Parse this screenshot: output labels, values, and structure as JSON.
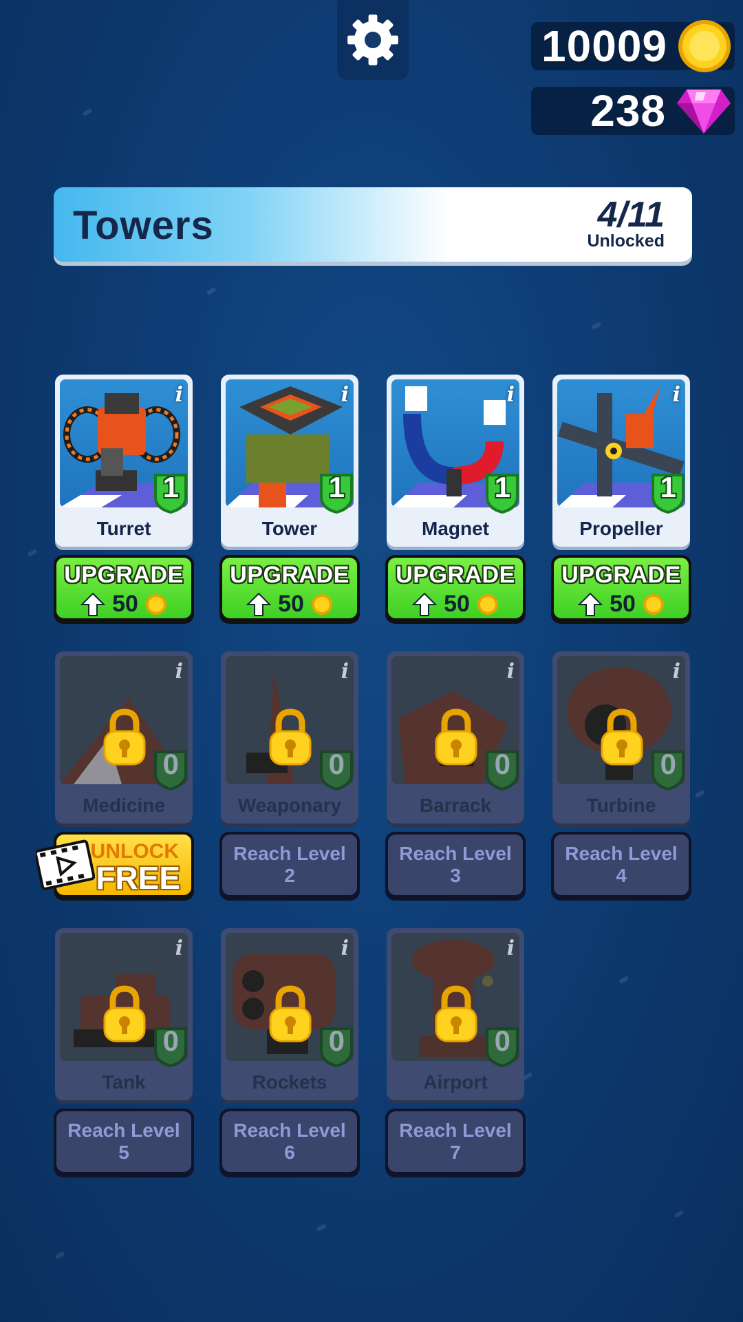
{
  "currency": {
    "coins": "10009",
    "gems": "238"
  },
  "header": {
    "title": "Towers",
    "count": "4/11",
    "unlocked_label": "Unlocked"
  },
  "towers": [
    {
      "name": "Turret",
      "level": "1",
      "locked": false,
      "upgrade_label": "UPGRADE",
      "price": "50"
    },
    {
      "name": "Tower",
      "level": "1",
      "locked": false,
      "upgrade_label": "UPGRADE",
      "price": "50"
    },
    {
      "name": "Magnet",
      "level": "1",
      "locked": false,
      "upgrade_label": "UPGRADE",
      "price": "50"
    },
    {
      "name": "Propeller",
      "level": "1",
      "locked": false,
      "upgrade_label": "UPGRADE",
      "price": "50"
    },
    {
      "name": "Medicine",
      "level": "0",
      "locked": true,
      "unlock_small": "UNLOCK",
      "unlock_big": "FREE"
    },
    {
      "name": "Weaponary",
      "level": "0",
      "locked": true,
      "req_line1": "Reach Level",
      "req_line2": "2"
    },
    {
      "name": "Barrack",
      "level": "0",
      "locked": true,
      "req_line1": "Reach Level",
      "req_line2": "3"
    },
    {
      "name": "Turbine",
      "level": "0",
      "locked": true,
      "req_line1": "Reach Level",
      "req_line2": "4"
    },
    {
      "name": "Tank",
      "level": "0",
      "locked": true,
      "req_line1": "Reach Level",
      "req_line2": "5"
    },
    {
      "name": "Rockets",
      "level": "0",
      "locked": true,
      "req_line1": "Reach Level",
      "req_line2": "6"
    },
    {
      "name": "Airport",
      "level": "0",
      "locked": true,
      "req_line1": "Reach Level",
      "req_line2": "7"
    }
  ],
  "info_glyph": "i",
  "icons": [
    "gear-icon",
    "coin-icon",
    "gem-icon",
    "info-icon",
    "level-shield-icon",
    "lock-icon",
    "arrow-up-icon",
    "video-film-icon"
  ],
  "colors": {
    "background": "#0e3c74",
    "upgrade_green": "#4fdc2c",
    "free_yellow": "#ffd21f",
    "locked_card": "#3f4b70",
    "header_text": "#15284b"
  }
}
